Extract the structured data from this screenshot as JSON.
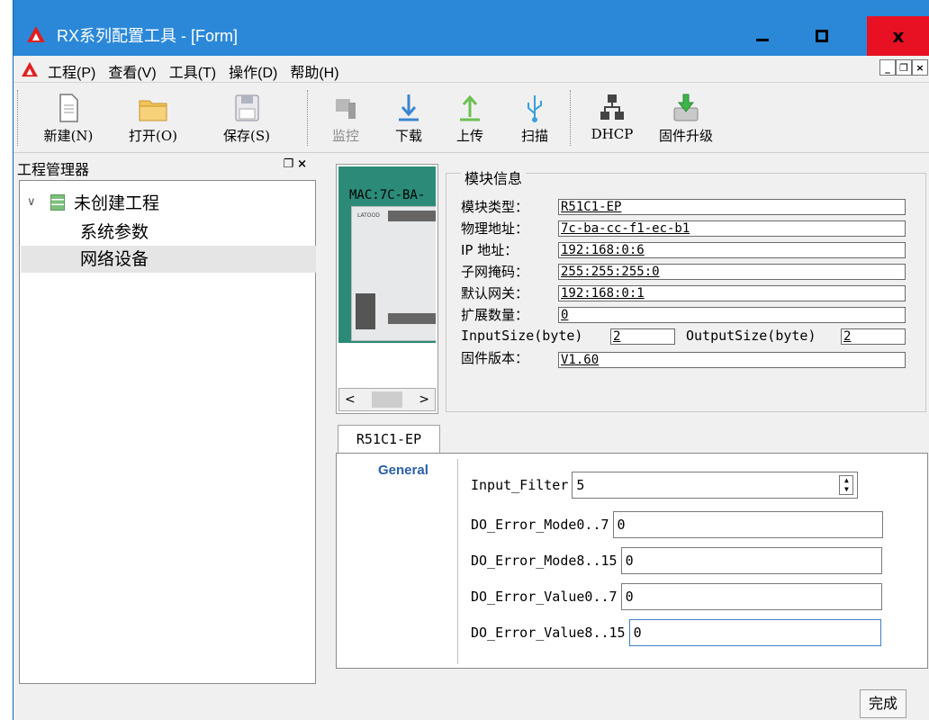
{
  "window": {
    "title": "RX系列配置工具 - [Form]"
  },
  "menu": {
    "items": [
      "工程(P)",
      "查看(V)",
      "工具(T)",
      "操作(D)",
      "帮助(H)"
    ]
  },
  "toolbar": {
    "new": "新建(N)",
    "open": "打开(O)",
    "save": "保存(S)",
    "monitor": "监控",
    "download": "下载",
    "upload": "上传",
    "scan": "扫描",
    "dhcp": "DHCP",
    "firmware": "固件升级"
  },
  "project": {
    "header": "工程管理器",
    "root": "未创建工程",
    "items": [
      "系统参数",
      "网络设备"
    ]
  },
  "module": {
    "mac": "MAC:7C-BA-",
    "brand": "LATOOD"
  },
  "info": {
    "legend": "模块信息",
    "type_label": "模块类型：",
    "type_value": "R51C1-EP",
    "phys_label": "物理地址：",
    "phys_value": "7c-ba-cc-f1-ec-b1",
    "ip_label": " IP 地址：",
    "ip_value": "192:168:0:6",
    "mask_label": "子网掩码：",
    "mask_value": "255:255:255:0",
    "gw_label": "默认网关：",
    "gw_value": "192:168:0:1",
    "ext_label": "扩展数量：",
    "ext_value": "0",
    "insize_label": "InputSize(byte)",
    "insize_value": "2",
    "outsize_label": "OutputSize(byte)",
    "outsize_value": "2",
    "fw_label": "固件版本：",
    "fw_value": "V1.60"
  },
  "tabs": {
    "active": "R51C1-EP",
    "section": "General"
  },
  "params": {
    "input_filter_label": "Input_Filter",
    "input_filter_value": "5",
    "do_mode_0_7_label": "DO_Error_Mode0..7",
    "do_mode_0_7_value": "0",
    "do_mode_8_15_label": "DO_Error_Mode8..15",
    "do_mode_8_15_value": "0",
    "do_val_0_7_label": "DO_Error_Value0..7",
    "do_val_0_7_value": "0",
    "do_val_8_15_label": "DO_Error_Value8..15",
    "do_val_8_15_value": "0"
  },
  "footer": {
    "done": "完成"
  },
  "colors": {
    "titlebar": "#2b88d8",
    "close": "#e81123",
    "accent": "#2a5fa8"
  }
}
